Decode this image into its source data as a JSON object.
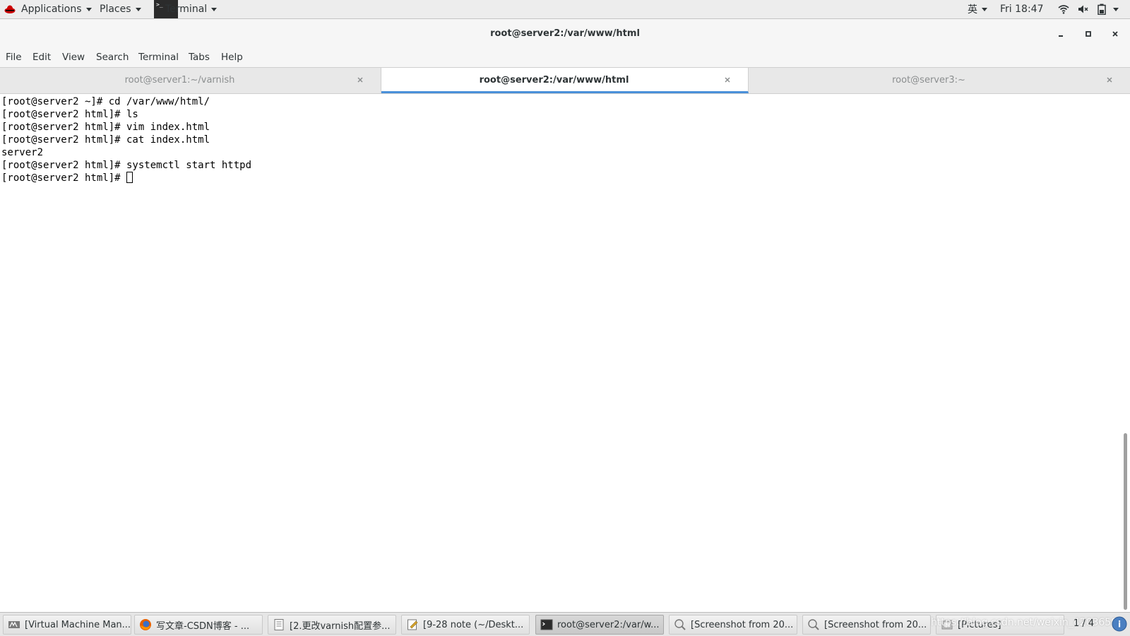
{
  "top_panel": {
    "applications": "Applications",
    "places": "Places",
    "terminal": "Terminal",
    "input_method": "英",
    "clock": "Fri 18:47"
  },
  "window": {
    "title": "root@server2:/var/www/html"
  },
  "menu": [
    "File",
    "Edit",
    "View",
    "Search",
    "Terminal",
    "Tabs",
    "Help"
  ],
  "tabs": [
    {
      "label": "root@server1:~/varnish",
      "active": false
    },
    {
      "label": "root@server2:/var/www/html",
      "active": true
    },
    {
      "label": "root@server3:~",
      "active": false
    }
  ],
  "terminal_lines": [
    "[root@server2 ~]# cd /var/www/html/",
    "[root@server2 html]# ls",
    "[root@server2 html]# vim index.html",
    "[root@server2 html]# cat index.html",
    "server2",
    "[root@server2 html]# systemctl start httpd",
    "[root@server2 html]# "
  ],
  "taskbar": {
    "items": [
      {
        "label": "[Virtual Machine Man...",
        "icon": "vm-manager-icon"
      },
      {
        "label": "写文章-CSDN博客 - ...",
        "icon": "firefox-icon"
      },
      {
        "label": "[2.更改varnish配置参...",
        "icon": "document-icon"
      },
      {
        "label": "[9-28 note (~/Deskt...",
        "icon": "text-editor-icon"
      },
      {
        "label": "root@server2:/var/w...",
        "icon": "terminal-icon",
        "active": true
      },
      {
        "label": "[Screenshot from 20...",
        "icon": "image-viewer-icon"
      },
      {
        "label": "[Screenshot from 20...",
        "icon": "image-viewer-icon"
      },
      {
        "label": "[Pictures]",
        "icon": "folder-icon"
      }
    ],
    "workspace": "1 / 4",
    "watermark": "https://blog.csdn.net/weixin_42036590"
  }
}
